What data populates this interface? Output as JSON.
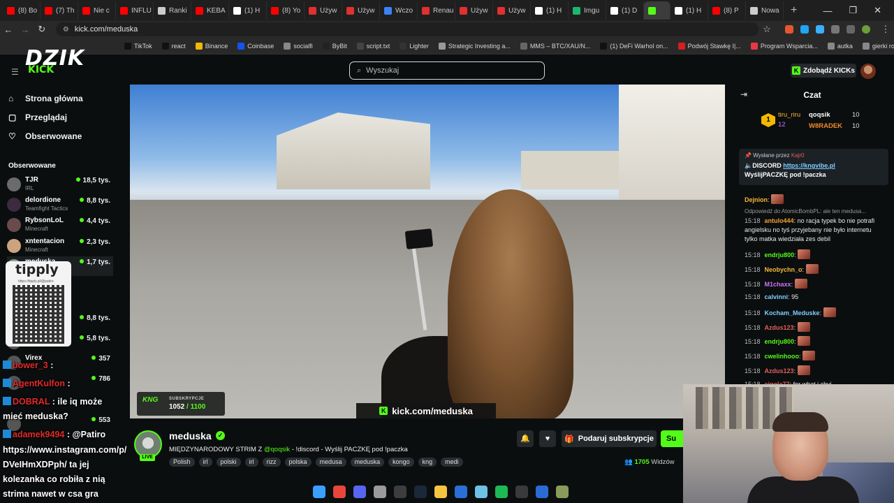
{
  "browser": {
    "tabs": [
      {
        "label": "(8) Bo",
        "color": "#ff0000"
      },
      {
        "label": "(7) Th",
        "color": "#ff0000"
      },
      {
        "label": "Nie c",
        "color": "#ff0000"
      },
      {
        "label": "INFLU",
        "color": "#ff0000"
      },
      {
        "label": "Ranki",
        "color": "#cccccc"
      },
      {
        "label": "KEBA",
        "color": "#ff0000"
      },
      {
        "label": "(1) H",
        "color": "#ffffff"
      },
      {
        "label": "(8) Yo",
        "color": "#ff0000"
      },
      {
        "label": "Używ",
        "color": "#e03030"
      },
      {
        "label": "Używ",
        "color": "#e03030"
      },
      {
        "label": "Wczo",
        "color": "#3b82f6"
      },
      {
        "label": "Renau",
        "color": "#e03030"
      },
      {
        "label": "Używ",
        "color": "#e03030"
      },
      {
        "label": "Używ",
        "color": "#e03030"
      },
      {
        "label": "(1) H",
        "color": "#ffffff"
      },
      {
        "label": "Imgu",
        "color": "#1bb76e"
      },
      {
        "label": "(1) D",
        "color": "#ffffff"
      },
      {
        "label": "",
        "color": "#53fc18",
        "active": true
      },
      {
        "label": "(1) H",
        "color": "#ffffff"
      },
      {
        "label": "(8) P",
        "color": "#ff0000"
      },
      {
        "label": "Nowa",
        "color": "#cccccc"
      }
    ],
    "new_tab": "+",
    "window_buttons": [
      "—",
      "❐",
      "✕"
    ],
    "url": "kick.com/meduska",
    "bookmarks": [
      {
        "label": "TikTok",
        "color": "#111111"
      },
      {
        "label": "react",
        "color": "#111111"
      },
      {
        "label": "Binance",
        "color": "#f0b90b"
      },
      {
        "label": "Coinbase",
        "color": "#1652f0"
      },
      {
        "label": "socialfi",
        "color": "#888888"
      },
      {
        "label": "ByBit",
        "color": "#222222"
      },
      {
        "label": "script.txt",
        "color": "#444444"
      },
      {
        "label": "Lighter",
        "color": "#333333"
      },
      {
        "label": "Strategic Investing a...",
        "color": "#999999"
      },
      {
        "label": "MMS – BTC/XAU/N...",
        "color": "#666666"
      },
      {
        "label": "(1) DeFi Warhol on...",
        "color": "#111111"
      },
      {
        "label": "Podwój Stawkę ǀ|...",
        "color": "#d42020"
      },
      {
        "label": "Program Wsparcia...",
        "color": "#e63946"
      },
      {
        "label": "autka",
        "color": "#888888"
      },
      {
        "label": "gierki roblowe do...",
        "color": "#888888"
      }
    ]
  },
  "kick": {
    "logo": "DZIK",
    "logo_sub": "KICK",
    "search_placeholder": "Wyszukaj",
    "kicks_button": "Zdobądź KICKs",
    "nav": [
      {
        "label": "Strona główna",
        "icon": "⌂"
      },
      {
        "label": "Przeglądaj",
        "icon": "▢"
      },
      {
        "label": "Obserwowane",
        "icon": "♡"
      }
    ],
    "followed_title": "Obserwowane",
    "followed": [
      {
        "name": "TJR",
        "category": "IRL",
        "viewers": "18,5 tys.",
        "color": "#6b6b6b"
      },
      {
        "name": "delordione",
        "category": "Teamfight Tactics",
        "viewers": "8,8 tys.",
        "color": "#3c2a3e"
      },
      {
        "name": "RybsonLoL",
        "category": "Minecraft",
        "viewers": "4,4 tys.",
        "color": "#6a4a4a"
      },
      {
        "name": "xntentacion",
        "category": "Minecraft",
        "viewers": "2,3 tys.",
        "color": "#cda37f"
      },
      {
        "name": "meduska",
        "category": "",
        "viewers": "1,7 tys.",
        "color": "#88a088"
      },
      {
        "name": "",
        "category": "",
        "viewers": "8,8 tys.",
        "color": "#555"
      },
      {
        "name": "",
        "category": "",
        "viewers": "5,8 tys.",
        "color": "#555"
      },
      {
        "name": "Virex",
        "category": "",
        "viewers": "357",
        "color": "#555"
      },
      {
        "name": "",
        "category": "",
        "viewers": "786",
        "color": "#555"
      },
      {
        "name": "",
        "category": "",
        "viewers": "553",
        "color": "#555"
      }
    ],
    "stream": {
      "sub_label": "SUBSKRYPCJE",
      "sub_current": "1052",
      "sub_goal": "/ 1100",
      "overlay_url": "kick.com/meduska",
      "streamer": "meduska",
      "live": "LIVE",
      "title_pre": "MIĘDZYNARODOWY STRIM Z ",
      "title_mention": "@qoqsik",
      "title_post": " - !discord - Wyślij PACZKĘ pod !paczka",
      "tags": [
        "Polish",
        "irl",
        "polski",
        "irl",
        "rizz",
        "polska",
        "medusa",
        "meduska",
        "kongo",
        "kng",
        "medi"
      ],
      "gift_button": "Podaruj subskrypcje",
      "subscribe_button": "Su",
      "viewers_count": "1705",
      "viewers_label": "Widzów"
    },
    "chat": {
      "title": "Czat",
      "gifters": [
        {
          "name": "tiru_riru",
          "count": "12"
        },
        {
          "name": "qoqsik",
          "count": "10"
        },
        {
          "name": "W8RADEK",
          "count": "10"
        }
      ],
      "pinned_by": "Wysłane przez",
      "pinned_user": "Kajr0",
      "pinned_msg_pre": "DISCORD ",
      "pinned_link": "https://kngvibe.pl",
      "pinned_msg_post": "WyślijPACZKĘ pod !paczka",
      "reply_ref": "Odpowiedź do AtomicBombPL: ale ten medusa...",
      "messages": [
        {
          "time": "",
          "user": "Dejnion",
          "color": "#f6b73c",
          "text": ""
        },
        {
          "time": "15:18",
          "user": "antulo444",
          "color": "#f0a030",
          "text": "no racja typek bo nie potrafi angielsku no tyś przyjebany nie było internetu tylko matka wiedziała zes debil"
        },
        {
          "time": "15:18",
          "user": "endrju800",
          "color": "#53fc18",
          "text": ""
        },
        {
          "time": "15:18",
          "user": "Neobychn_o",
          "color": "#f6b73c",
          "text": ""
        },
        {
          "time": "15:18",
          "user": "M1chaxx",
          "color": "#c872ff",
          "text": ""
        },
        {
          "time": "15:18",
          "user": "calvinni",
          "color": "#7ecfff",
          "text": "95"
        },
        {
          "time": "15:18",
          "user": "Kocham_Meduske",
          "color": "#7ecfff",
          "text": ""
        },
        {
          "time": "15:18",
          "user": "Azdus123",
          "color": "#e35d5d",
          "text": ""
        },
        {
          "time": "15:18",
          "user": "endrju800",
          "color": "#53fc18",
          "text": ""
        },
        {
          "time": "15:18",
          "user": "cwelinhooo",
          "color": "#53fc18",
          "text": ""
        },
        {
          "time": "15:18",
          "user": "Azdus123",
          "color": "#e35d5d",
          "text": ""
        },
        {
          "time": "15:18",
          "user": "ejgola77",
          "color": "#e35d5d",
          "text": "for what i chyi"
        }
      ]
    }
  },
  "overlay": {
    "tipply_logo": "tipply",
    "tipply_url": "https://tipply.pl/@patiro",
    "chat": [
      {
        "user": "bower_3",
        "text": ":"
      },
      {
        "user": "AgentKulfon",
        "text": ":"
      },
      {
        "user": "DOBRAL",
        "text": ": ile iq może"
      },
      {
        "user": "",
        "text": "mieć meduska?"
      },
      {
        "user": "adamek9494",
        "text": ": @Patiro"
      },
      {
        "user": "",
        "text": "https://www.instagram.com/p/"
      },
      {
        "user": "",
        "text": "DVeIHmXDPph/ ta jej"
      },
      {
        "user": "",
        "text": "kolezanka co robiła z nią"
      },
      {
        "user": "",
        "text": "strima nawet w csa gra"
      }
    ]
  },
  "taskbar": [
    {
      "name": "windows-start",
      "color": "#3aa0ff"
    },
    {
      "name": "chrome",
      "color": "#e8453c"
    },
    {
      "name": "discord",
      "color": "#5865f2"
    },
    {
      "name": "app",
      "color": "#9a9a9a"
    },
    {
      "name": "obs",
      "color": "#3d3d3d"
    },
    {
      "name": "steam",
      "color": "#1b2838"
    },
    {
      "name": "files",
      "color": "#f5c542"
    },
    {
      "name": "ccleaner",
      "color": "#2a6fd6"
    },
    {
      "name": "app2",
      "color": "#6ec1e4"
    },
    {
      "name": "spotify",
      "color": "#1db954"
    },
    {
      "name": "app3",
      "color": "#3a3a3a"
    },
    {
      "name": "app4",
      "color": "#2c6bd6"
    },
    {
      "name": "app5",
      "color": "#8a9a5a"
    }
  ]
}
